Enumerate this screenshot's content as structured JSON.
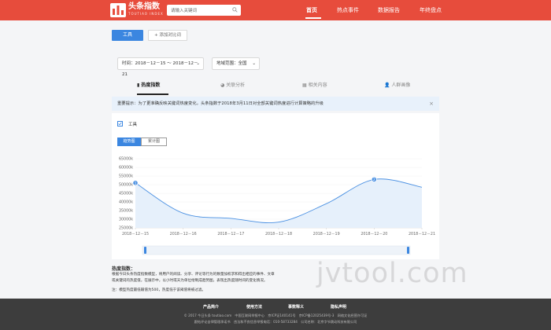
{
  "header": {
    "logo_title": "头条指数",
    "logo_sub": "TOUTIAO INDEX",
    "search_placeholder": "请输入关键词",
    "nav": [
      {
        "label": "首页",
        "active": true
      },
      {
        "label": "热点事件",
        "active": false
      },
      {
        "label": "数据报告",
        "active": false
      },
      {
        "label": "年终盘点",
        "active": false
      }
    ]
  },
  "toolbar": {
    "tool_label": "工具",
    "add_compare_label": "+ 添加对比词"
  },
  "filters": {
    "time_label": "时间：2018－12－15 ～ 2018－12－21",
    "region_label": "地域范围：全国"
  },
  "tabs": [
    {
      "label": "热度指数",
      "active": true
    },
    {
      "label": "关联分析",
      "active": false
    },
    {
      "label": "相关内容",
      "active": false
    },
    {
      "label": "人群画像",
      "active": false
    }
  ],
  "notice": {
    "text": "重要提示：为了更准确反映关键词热度变化，头条指数于2018年3月11日对全部关键词热度进行计算策略的升级"
  },
  "legend": {
    "keyword": "工具"
  },
  "view_toggle": {
    "trend": "趋势图",
    "cumulative": "累计图"
  },
  "chart_data": {
    "type": "area",
    "x": [
      "2018－12－15",
      "2018－12－16",
      "2018－12－17",
      "2018－12－18",
      "2018－12－19",
      "2018－12－20",
      "2018－12－21"
    ],
    "series": [
      {
        "name": "工具",
        "values": [
          51000,
          33500,
          30500,
          28300,
          39000,
          53000,
          48500
        ]
      }
    ],
    "y_ticks": [
      "25000k",
      "30000k",
      "35000k",
      "40000k",
      "45000k",
      "50000k",
      "55000k",
      "60000k",
      "65000k"
    ],
    "ylim": [
      25000,
      65000
    ],
    "markers": [
      {
        "x_index": 0,
        "label": "1"
      },
      {
        "x_index": 5,
        "label": "2"
      }
    ],
    "color": "#4a90e2",
    "fill": "#e6f0fb"
  },
  "explain": {
    "title": "热度指数：",
    "line1": "根据今日头条热度指数模型，将用户的阅读、分享、评论等行为的数量加权求和得出相应的事件、文章",
    "line2": "或关键词的热度值，在展示中，以小时或天为单位绘制成趋势图，表现出热度随时间的变化情况。",
    "note": "注：模型热度最低输值为500，热度低于该阈值将被过滤。"
  },
  "footer": {
    "links": [
      "产品简介",
      "使用方法",
      "事数释义",
      "隐私声明"
    ],
    "line1": "© 2017 今日头条 toutiao.com　中国互联网举报中心　京ICP证140141号　京ICP备12025439号-3　网络文化经营许可证",
    "line2": "跟帖评论自律管理承诺书　违法和不良信息举报电话：010-58733284　公司名称：北京字节跳动科技有限公司"
  },
  "watermark": "jvtool.com"
}
